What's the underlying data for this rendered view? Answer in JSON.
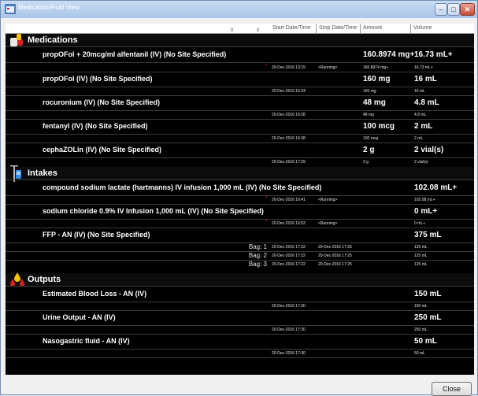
{
  "window": {
    "title": "Medication/Fluid View"
  },
  "columns": {
    "zero1": "0",
    "zero2": "0",
    "start": "Start Date/Time",
    "stop": "Stop Date/Time",
    "amount": "Amount",
    "volume": "Volume"
  },
  "sections": {
    "medications": "Medications",
    "intakes": "Intakes",
    "outputs": "Outputs"
  },
  "medications": [
    {
      "name": "propOFol + 20mcg/ml alfentanil (IV) (No Site Specified)",
      "amount": "160.8974 mg+",
      "volume": "16.73 mL+",
      "star": "*",
      "start": "20-Dec-2016 13:19",
      "stop": "<Running>",
      "amount_small": "160.8974 mg+",
      "volume_small": "16.73 mL+"
    },
    {
      "name": "propOFol (IV) (No Site Specified)",
      "amount": "160 mg",
      "volume": "16 mL",
      "start": "20-Dec-2016 16:24",
      "amount_small": "160 mg",
      "volume_small": "16 mL"
    },
    {
      "name": "rocuronium (IV) (No Site Specified)",
      "amount": "48 mg",
      "volume": "4.8 mL",
      "start": "20-Dec-2016 16:28",
      "amount_small": "48 mg",
      "volume_small": "4.8 mL"
    },
    {
      "name": "fentanyl (IV) (No Site Specified)",
      "amount": "100 mcg",
      "volume": "2 mL",
      "start": "20-Dec-2016 16:38",
      "amount_small": "100 mcg",
      "volume_small": "2 mL"
    },
    {
      "name": "cephaZOLin (IV) (No Site Specified)",
      "amount": "2 g",
      "volume": "2 vial(s)",
      "start": "20-Dec-2016 17:29",
      "amount_small": "2 g",
      "volume_small": "2 vial(s)"
    }
  ],
  "intakes": [
    {
      "name": "compound sodium lactate (hartmanns) IV infusion 1,000 mL (IV) (No Site Specified)",
      "volume": "102.08 mL+",
      "star": "*",
      "start": "20-Dec-2016 16:41",
      "stop": "<Running>",
      "volume_small": "102.08 mL+"
    },
    {
      "name": "sodium chloride 0.9% IV Infusion 1,000 mL (IV) (No Site Specified)",
      "volume": "0 mL+",
      "star": "*",
      "start": "20-Dec-2016 16:53",
      "stop": "<Running>",
      "volume_small": "0 mL+"
    },
    {
      "name": "FFP - AN (IV) (No Site Specified)",
      "volume": "375 mL",
      "bags": [
        {
          "label": "Bag: 1",
          "start": "20-Dec-2016 17:22",
          "stop": "20-Dec-2016 17:25",
          "volume": "125 mL"
        },
        {
          "label": "Bag: 2",
          "start": "20-Dec-2016 17:22",
          "stop": "20-Dec-2016 17:25",
          "volume": "125 mL"
        },
        {
          "label": "Bag: 3",
          "start": "20-Dec-2016 17:22",
          "stop": "20-Dec-2016 17:25",
          "volume": "125 mL"
        }
      ]
    }
  ],
  "outputs": [
    {
      "name": "Estimated Blood Loss - AN (IV)",
      "volume": "150 mL",
      "start": "20-Dec-2016 17:30",
      "volume_small": "150 mL"
    },
    {
      "name": "Urine Output - AN (IV)",
      "volume": "250 mL",
      "start": "20-Dec-2016 17:30",
      "volume_small": "250 mL"
    },
    {
      "name": "Nasogastric fluid - AN (IV)",
      "volume": "50 mL",
      "start": "20-Dec-2016 17:30",
      "volume_small": "50 mL"
    }
  ],
  "footer": {
    "close_label": "Close"
  },
  "colors": {
    "background": "#000000",
    "title_bar": "#a9c5e8",
    "running_star": "#ff3030"
  }
}
